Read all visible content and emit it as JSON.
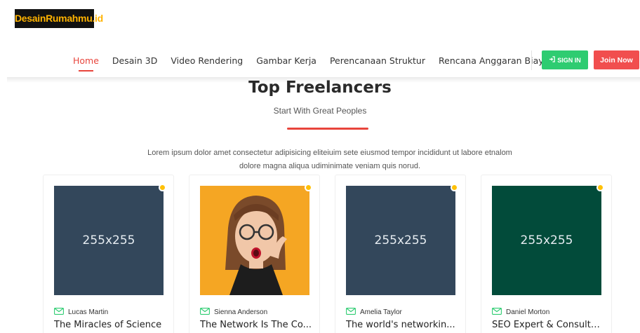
{
  "brand": {
    "logo_text": "DesainRumahmu.id"
  },
  "nav": {
    "items": [
      {
        "label": "Home",
        "active": true
      },
      {
        "label": "Desain 3D",
        "active": false
      },
      {
        "label": "Video Rendering",
        "active": false
      },
      {
        "label": "Gambar Kerja",
        "active": false
      },
      {
        "label": "Perencanaan Struktur",
        "active": false
      },
      {
        "label": "Rencana Anggaran Biaya",
        "active": false
      }
    ],
    "signin_label": "SIGN IN",
    "join_label": "Join Now"
  },
  "section": {
    "title": "Top Freelancers",
    "subtitle": "Start With Great Peoples",
    "description": "Lorem ipsum dolor amet consectetur adipisicing eliteiuim sete eiusmod tempor incididunt ut labore etnalom dolore magna aliqua udiminimate veniam quis norud."
  },
  "cards": [
    {
      "image_label": "255x255",
      "image_color": "#33475b",
      "author": "Lucas Martin",
      "title": "The Miracles of Science"
    },
    {
      "image_label": "",
      "image_color": "#f5a623",
      "author": "Sienna Anderson",
      "title": "The Network Is The Co..."
    },
    {
      "image_label": "255x255",
      "image_color": "#33475b",
      "author": "Amelia Taylor",
      "title": "The world's networkin..."
    },
    {
      "image_label": "255x255",
      "image_color": "#024b3a",
      "author": "Daniel Morton",
      "title": "SEO Expert & Consulta..."
    }
  ],
  "colors": {
    "accent": "#e8453c",
    "signin": "#2ecc71",
    "join": "#f14e4e",
    "status_dot": "#ffc107"
  }
}
